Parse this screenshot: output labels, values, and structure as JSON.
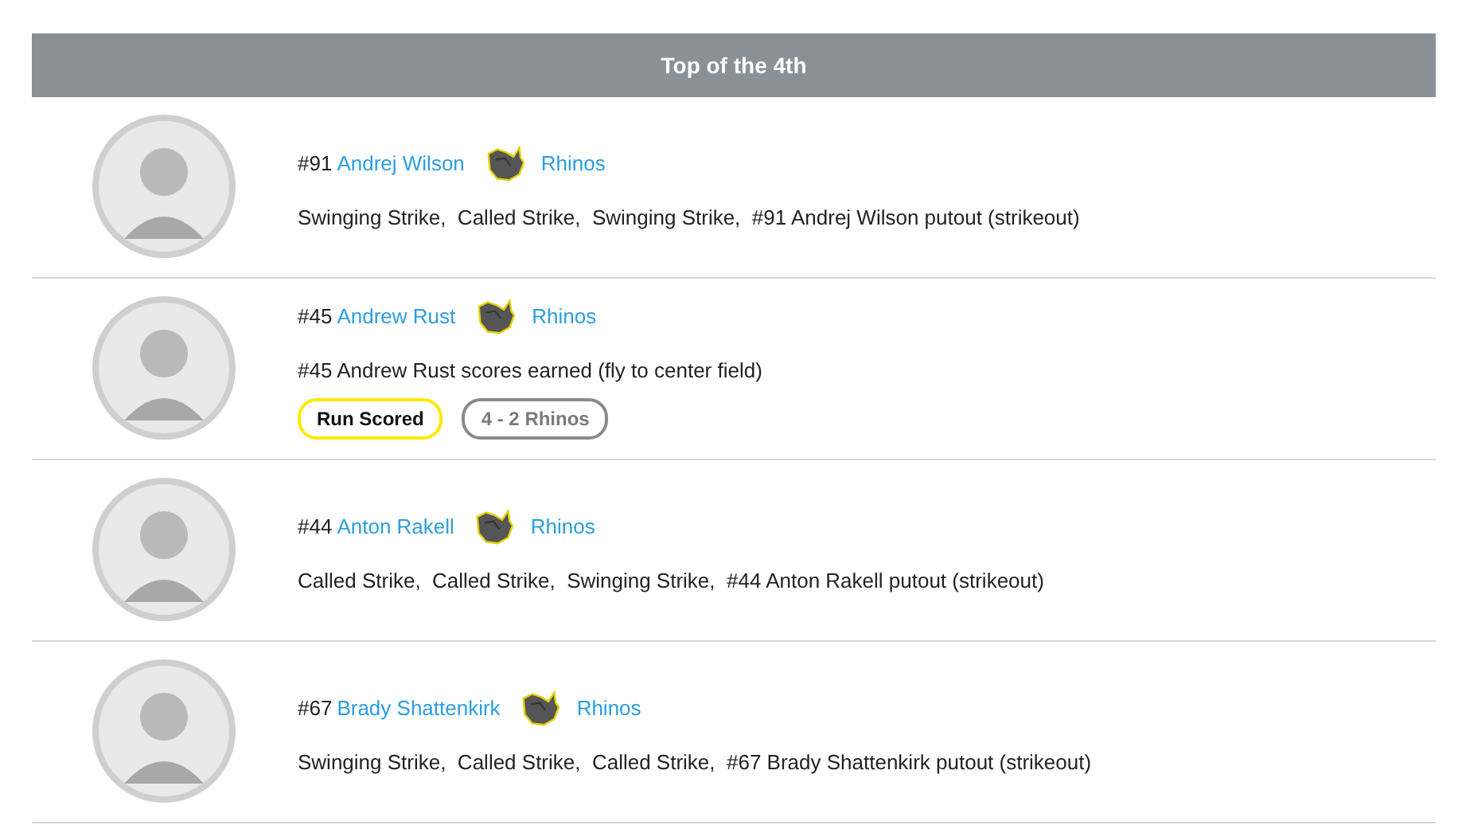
{
  "period": {
    "title": "Top of the 4th"
  },
  "plays": [
    {
      "jersey": "#91",
      "player": "Andrej Wilson",
      "team": "Rhinos",
      "description": "Swinging Strike,  Called Strike,  Swinging Strike,  #91 Andrej Wilson putout (strikeout)"
    },
    {
      "jersey": "#45",
      "player": "Andrew Rust",
      "team": "Rhinos",
      "description": "#45 Andrew Rust scores earned (fly to center field)",
      "tags": [
        {
          "kind": "event",
          "label": "Run Scored"
        },
        {
          "kind": "score",
          "label": "4 - 2 Rhinos"
        }
      ]
    },
    {
      "jersey": "#44",
      "player": "Anton Rakell",
      "team": "Rhinos",
      "description": "Called Strike,  Called Strike,  Swinging Strike,  #44 Anton Rakell putout (strikeout)"
    },
    {
      "jersey": "#67",
      "player": "Brady Shattenkirk",
      "team": "Rhinos",
      "description": "Swinging Strike,  Called Strike,  Called Strike,  #67 Brady Shattenkirk putout (strikeout)"
    }
  ]
}
